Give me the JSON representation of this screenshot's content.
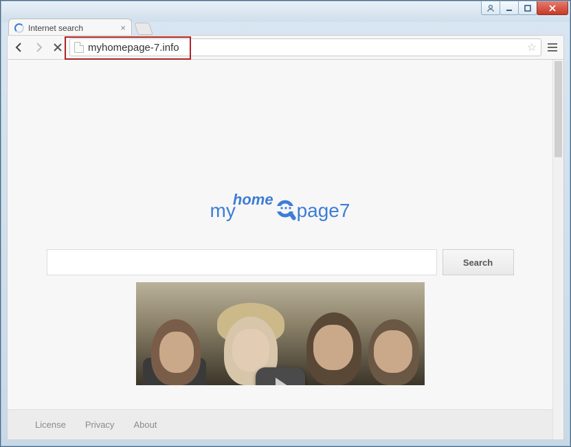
{
  "window": {
    "controls": {
      "user": "user",
      "min": "minimize",
      "max": "maximize",
      "close": "close"
    }
  },
  "browser": {
    "tab_title": "Internet search",
    "url": "myhomepage-7.info"
  },
  "page": {
    "logo": {
      "part1": "my",
      "part2": "home",
      "part3": "page7"
    },
    "search_button": "Search",
    "search_value": ""
  },
  "footer": {
    "links": [
      "License",
      "Privacy",
      "About"
    ]
  }
}
